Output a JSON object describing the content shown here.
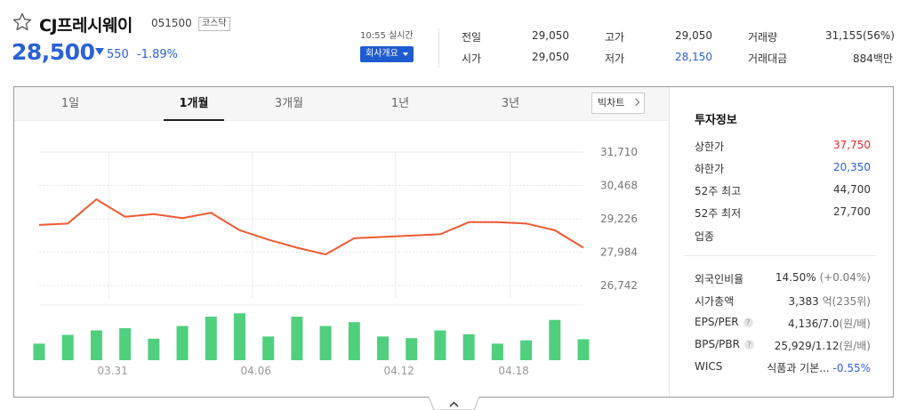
{
  "header": {
    "name": "CJ프레시웨이",
    "code": "051500",
    "market": "코스닥",
    "price": "28,500",
    "change_amount": "550",
    "change_rate": "-1.89%",
    "time_label": "10:55 실시간",
    "company_button": "회사개요"
  },
  "quote": [
    {
      "label": "전일",
      "value": "29,050",
      "color": ""
    },
    {
      "label": "시가",
      "value": "29,050",
      "color": ""
    },
    {
      "label": "고가",
      "value": "29,050",
      "color": ""
    },
    {
      "label": "저가",
      "value": "28,150",
      "color": "#2a62d6"
    },
    {
      "label": "거래량",
      "value": "31,155(56%)",
      "color": ""
    },
    {
      "label": "거래대금",
      "value": "884백만",
      "color": ""
    }
  ],
  "tabs": [
    "1일",
    "1개월",
    "3개월",
    "1년",
    "3년"
  ],
  "active_tab": "1개월",
  "bigchart_label": "빅차트",
  "chart_data": {
    "type": "line",
    "y_ticks": [
      "31,710",
      "30,468",
      "29,226",
      "27,984",
      "26,742"
    ],
    "y_range": [
      26742,
      31710
    ],
    "x_labels": [
      "03.31",
      "04.06",
      "04.12",
      "04.18"
    ],
    "price_color": "#f05a33",
    "volume_color": "#50cf7f",
    "series": [
      {
        "values": [
          29000,
          29050,
          29950,
          29300,
          29400,
          29250,
          29450,
          28800,
          28450,
          28150,
          27900,
          28500,
          28550,
          28600,
          28650,
          29100,
          29100,
          29050,
          28800,
          28150
        ]
      },
      {
        "values": [
          30,
          46,
          54,
          58,
          39,
          62,
          79,
          85,
          43,
          79,
          62,
          69,
          43,
          40,
          54,
          47,
          30,
          36,
          73,
          38
        ]
      }
    ]
  },
  "invest": {
    "title": "투자정보",
    "rows": [
      {
        "label": "상한가",
        "value": "37,750",
        "color": "#e6282b"
      },
      {
        "label": "하한가",
        "value": "20,350",
        "color": "#2a62d6"
      },
      {
        "label": "52주 최고",
        "value": "44,700",
        "color": ""
      },
      {
        "label": "52주 최저",
        "value": "27,700",
        "color": ""
      },
      {
        "label": "업종",
        "value": "",
        "color": ""
      }
    ],
    "rows2": [
      {
        "label": "외국인비율",
        "value": "14.50%",
        "unit": "(+0.04%)",
        "help": false
      },
      {
        "label": "시가총액",
        "value": "3,383",
        "unit": "억(235위)",
        "help": false
      },
      {
        "label": "EPS/PER",
        "value": "4,136/7.0",
        "unit": "(원/배)",
        "help": true
      },
      {
        "label": "BPS/PBR",
        "value": "25,929/1.12",
        "unit": "(원/배)",
        "help": true
      }
    ],
    "wics": {
      "label": "WICS",
      "sector": "식품과 기본...",
      "value": "-0.55%"
    }
  }
}
